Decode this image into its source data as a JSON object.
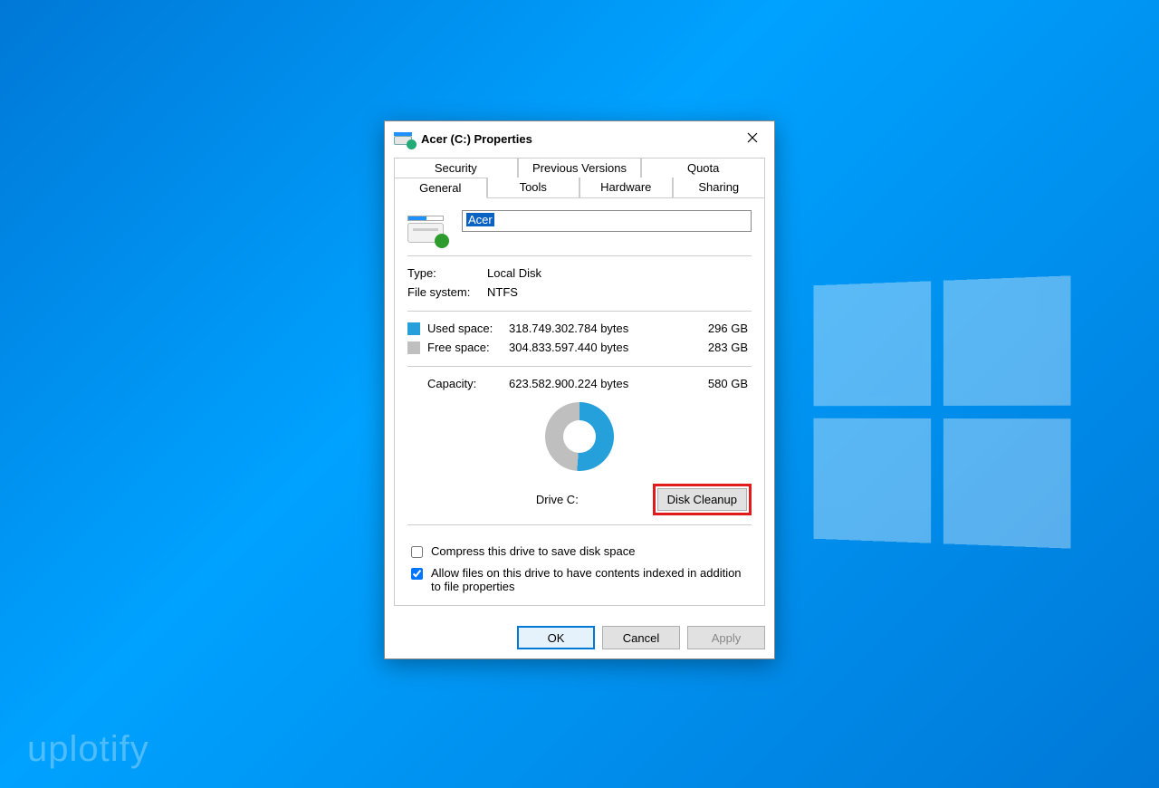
{
  "watermark": "uplotify",
  "window": {
    "title": "Acer (C:) Properties"
  },
  "tabs": {
    "row1": [
      "Security",
      "Previous Versions",
      "Quota"
    ],
    "row2": [
      "General",
      "Tools",
      "Hardware",
      "Sharing"
    ],
    "active": "General"
  },
  "general": {
    "drive_name": "Acer",
    "type_label": "Type:",
    "type_value": "Local Disk",
    "fs_label": "File system:",
    "fs_value": "NTFS",
    "used_label": "Used space:",
    "used_bytes": "318.749.302.784 bytes",
    "used_human": "296 GB",
    "free_label": "Free space:",
    "free_bytes": "304.833.597.440 bytes",
    "free_human": "283 GB",
    "capacity_label": "Capacity:",
    "capacity_bytes": "623.582.900.224 bytes",
    "capacity_human": "580 GB",
    "drive_label": "Drive C:",
    "cleanup_button": "Disk Cleanup",
    "compress_label": "Compress this drive to save disk space",
    "index_label": "Allow files on this drive to have contents indexed in addition to file properties",
    "compress_checked": false,
    "index_checked": true
  },
  "buttons": {
    "ok": "OK",
    "cancel": "Cancel",
    "apply": "Apply"
  },
  "colors": {
    "used": "#26a0da",
    "free": "#bfbfbf",
    "highlight": "#e11b1b",
    "accent": "#0078d7"
  }
}
